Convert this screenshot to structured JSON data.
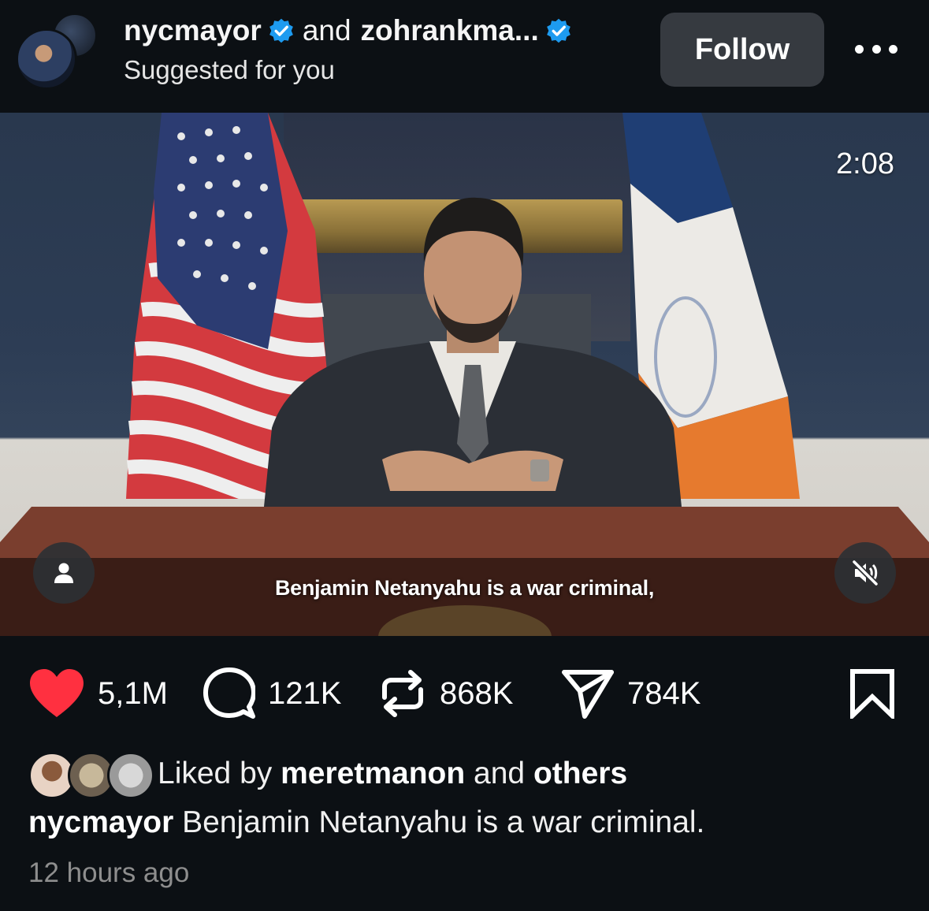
{
  "header": {
    "account_primary": "nycmayor",
    "connector": "and",
    "account_secondary": "zohrankma...",
    "subtitle": "Suggested for you",
    "follow_label": "Follow",
    "more_icon": "more-horizontal-icon"
  },
  "video": {
    "duration": "2:08",
    "caption": "Benjamin Netanyahu is a war criminal,",
    "muted": true
  },
  "actions": {
    "likes": "5,1M",
    "comments": "121K",
    "reposts": "868K",
    "shares": "784K",
    "like_color": "#ff3040"
  },
  "meta": {
    "liked_prefix": "Liked by",
    "liked_user": "meretmanon",
    "liked_and": "and",
    "liked_others": "others",
    "caption_user": "nycmayor",
    "caption_text": " Benjamin Netanyahu is a war criminal.",
    "time_ago": "12 hours ago"
  },
  "colors": {
    "background": "#0c1014",
    "verified": "#1d9bf0",
    "button_bg": "#363a40",
    "muted_text": "#8e8e8e"
  }
}
